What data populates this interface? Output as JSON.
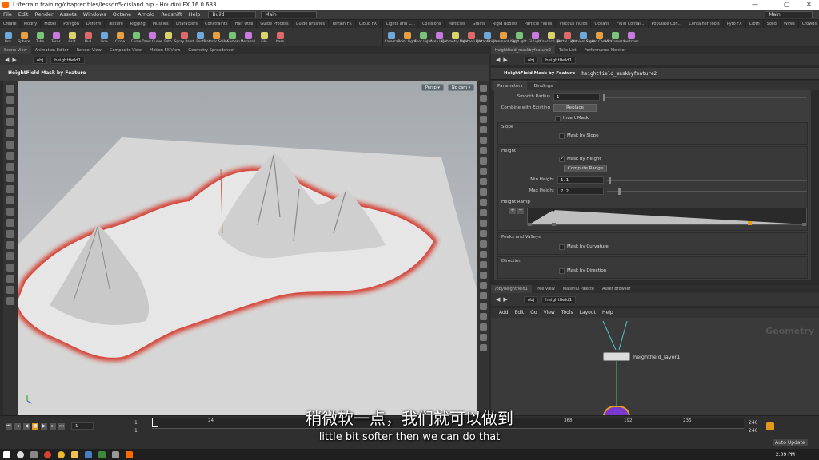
{
  "window": {
    "title": "L:/terrain training/chapter files/lesson5-cisland.hip - Houdini FX 16.0.633"
  },
  "menubar": {
    "items": [
      "File",
      "Edit",
      "Render",
      "Assets",
      "Windows",
      "Octane",
      "Arnold",
      "Redshift",
      "Help"
    ],
    "build_dropdown": "Build",
    "main_dropdown": "Main",
    "desktop_dropdown": "Main"
  },
  "shelf_left": {
    "tabs": [
      "Create",
      "Modify",
      "Model",
      "Polygon",
      "Deform",
      "Texture",
      "Rigging",
      "Muscles",
      "Characters",
      "Constraints",
      "Hair Utils",
      "Guide Process",
      "Guide Brushes",
      "Terrain FX",
      "Cloud FX",
      "Volume"
    ],
    "tools": [
      "Box",
      "Sphere",
      "Tube",
      "Torus",
      "Grid",
      "Null",
      "Line",
      "Circle",
      "Curve",
      "Draw Curve",
      "Path",
      "Spray Paint",
      "Font",
      "Platonic Solids",
      "L-System",
      "Metaball",
      "File",
      "base"
    ]
  },
  "shelf_right": {
    "tabs": [
      "Lights and C...",
      "Collisions",
      "Particles",
      "Grains",
      "Rigid Bodies",
      "Particle Fluids",
      "Viscous Fluids",
      "Oceans",
      "Fluid Contai...",
      "Populate Con...",
      "Container Tools",
      "Pyro FX",
      "Cloth",
      "Solid",
      "Wires",
      "Crowds",
      "Drive Simula..."
    ],
    "tools": [
      "Camera",
      "Point Light",
      "Spot Light",
      "Area Light",
      "Geometry Light",
      "Volume Light",
      "Distant Light",
      "Environment Light",
      "Sky Light",
      "GI Light",
      "Caustic Light",
      "Portal Light",
      "Ambient Light",
      "Stereo Camera",
      "VR Camera",
      "Switcher"
    ]
  },
  "viewport_pane": {
    "tabs": [
      "Scene View",
      "Animation Editor",
      "Render View",
      "Composite View",
      "Motion FX View",
      "Geometry Spreadsheet"
    ],
    "path": [
      "obj",
      "heightfield1"
    ],
    "title": "HeightField Mask by Feature",
    "persp": "Persp ▾",
    "cam": "No cam ▾"
  },
  "param_pane": {
    "tabs": [
      "heightfield_maskbyfeature2",
      "Take List",
      "Performance Monitor"
    ],
    "path": [
      "obj",
      "heightfield1"
    ],
    "node_type": "HeightField Mask by Feature",
    "node_name": "heightfield_maskbyfeature2",
    "subtabs": [
      "Parameters",
      "Bindings"
    ],
    "smooth_radius_label": "Smooth Radius",
    "smooth_radius": "1",
    "combine_label": "Combine with Existing",
    "combine_value": "Replace",
    "invert_label": "Invert Mask",
    "slope_folder": "Slope",
    "mask_by_slope": "Mask by Slope",
    "height_folder": "Height",
    "mask_by_height": "Mask by Height",
    "compute_range": "Compute Range",
    "min_height_label": "Min Height",
    "min_height": "1.1",
    "max_height_label": "Max Height",
    "max_height": "7.2",
    "ramp_label": "Height Ramp",
    "peaks_folder": "Peaks and Valleys",
    "mask_by_curvature": "Mask by Curvature",
    "direction_folder": "Direction",
    "mask_by_direction": "Mask by Direction"
  },
  "network_pane": {
    "tabs": [
      "/obj/heightfield1",
      "Tree View",
      "Material Palette",
      "Asset Browser"
    ],
    "path": [
      "obj",
      "heightfield1"
    ],
    "menu": [
      "Add",
      "Edit",
      "Go",
      "View",
      "Tools",
      "Layout",
      "Help"
    ],
    "context_label": "Geometry",
    "node_label": "heightfield_layer1"
  },
  "timeline": {
    "frame": "1",
    "start": "1",
    "start2": "1",
    "ticks": [
      "24",
      "368",
      "192",
      "236"
    ],
    "end": "240",
    "end2": "240",
    "auto_update": "Auto Update"
  },
  "subtitles": {
    "chinese": "稍微软一点，我们就可以做到",
    "english": "little bit softer then we can do that"
  },
  "taskbar": {
    "time": "2:09 PM"
  }
}
